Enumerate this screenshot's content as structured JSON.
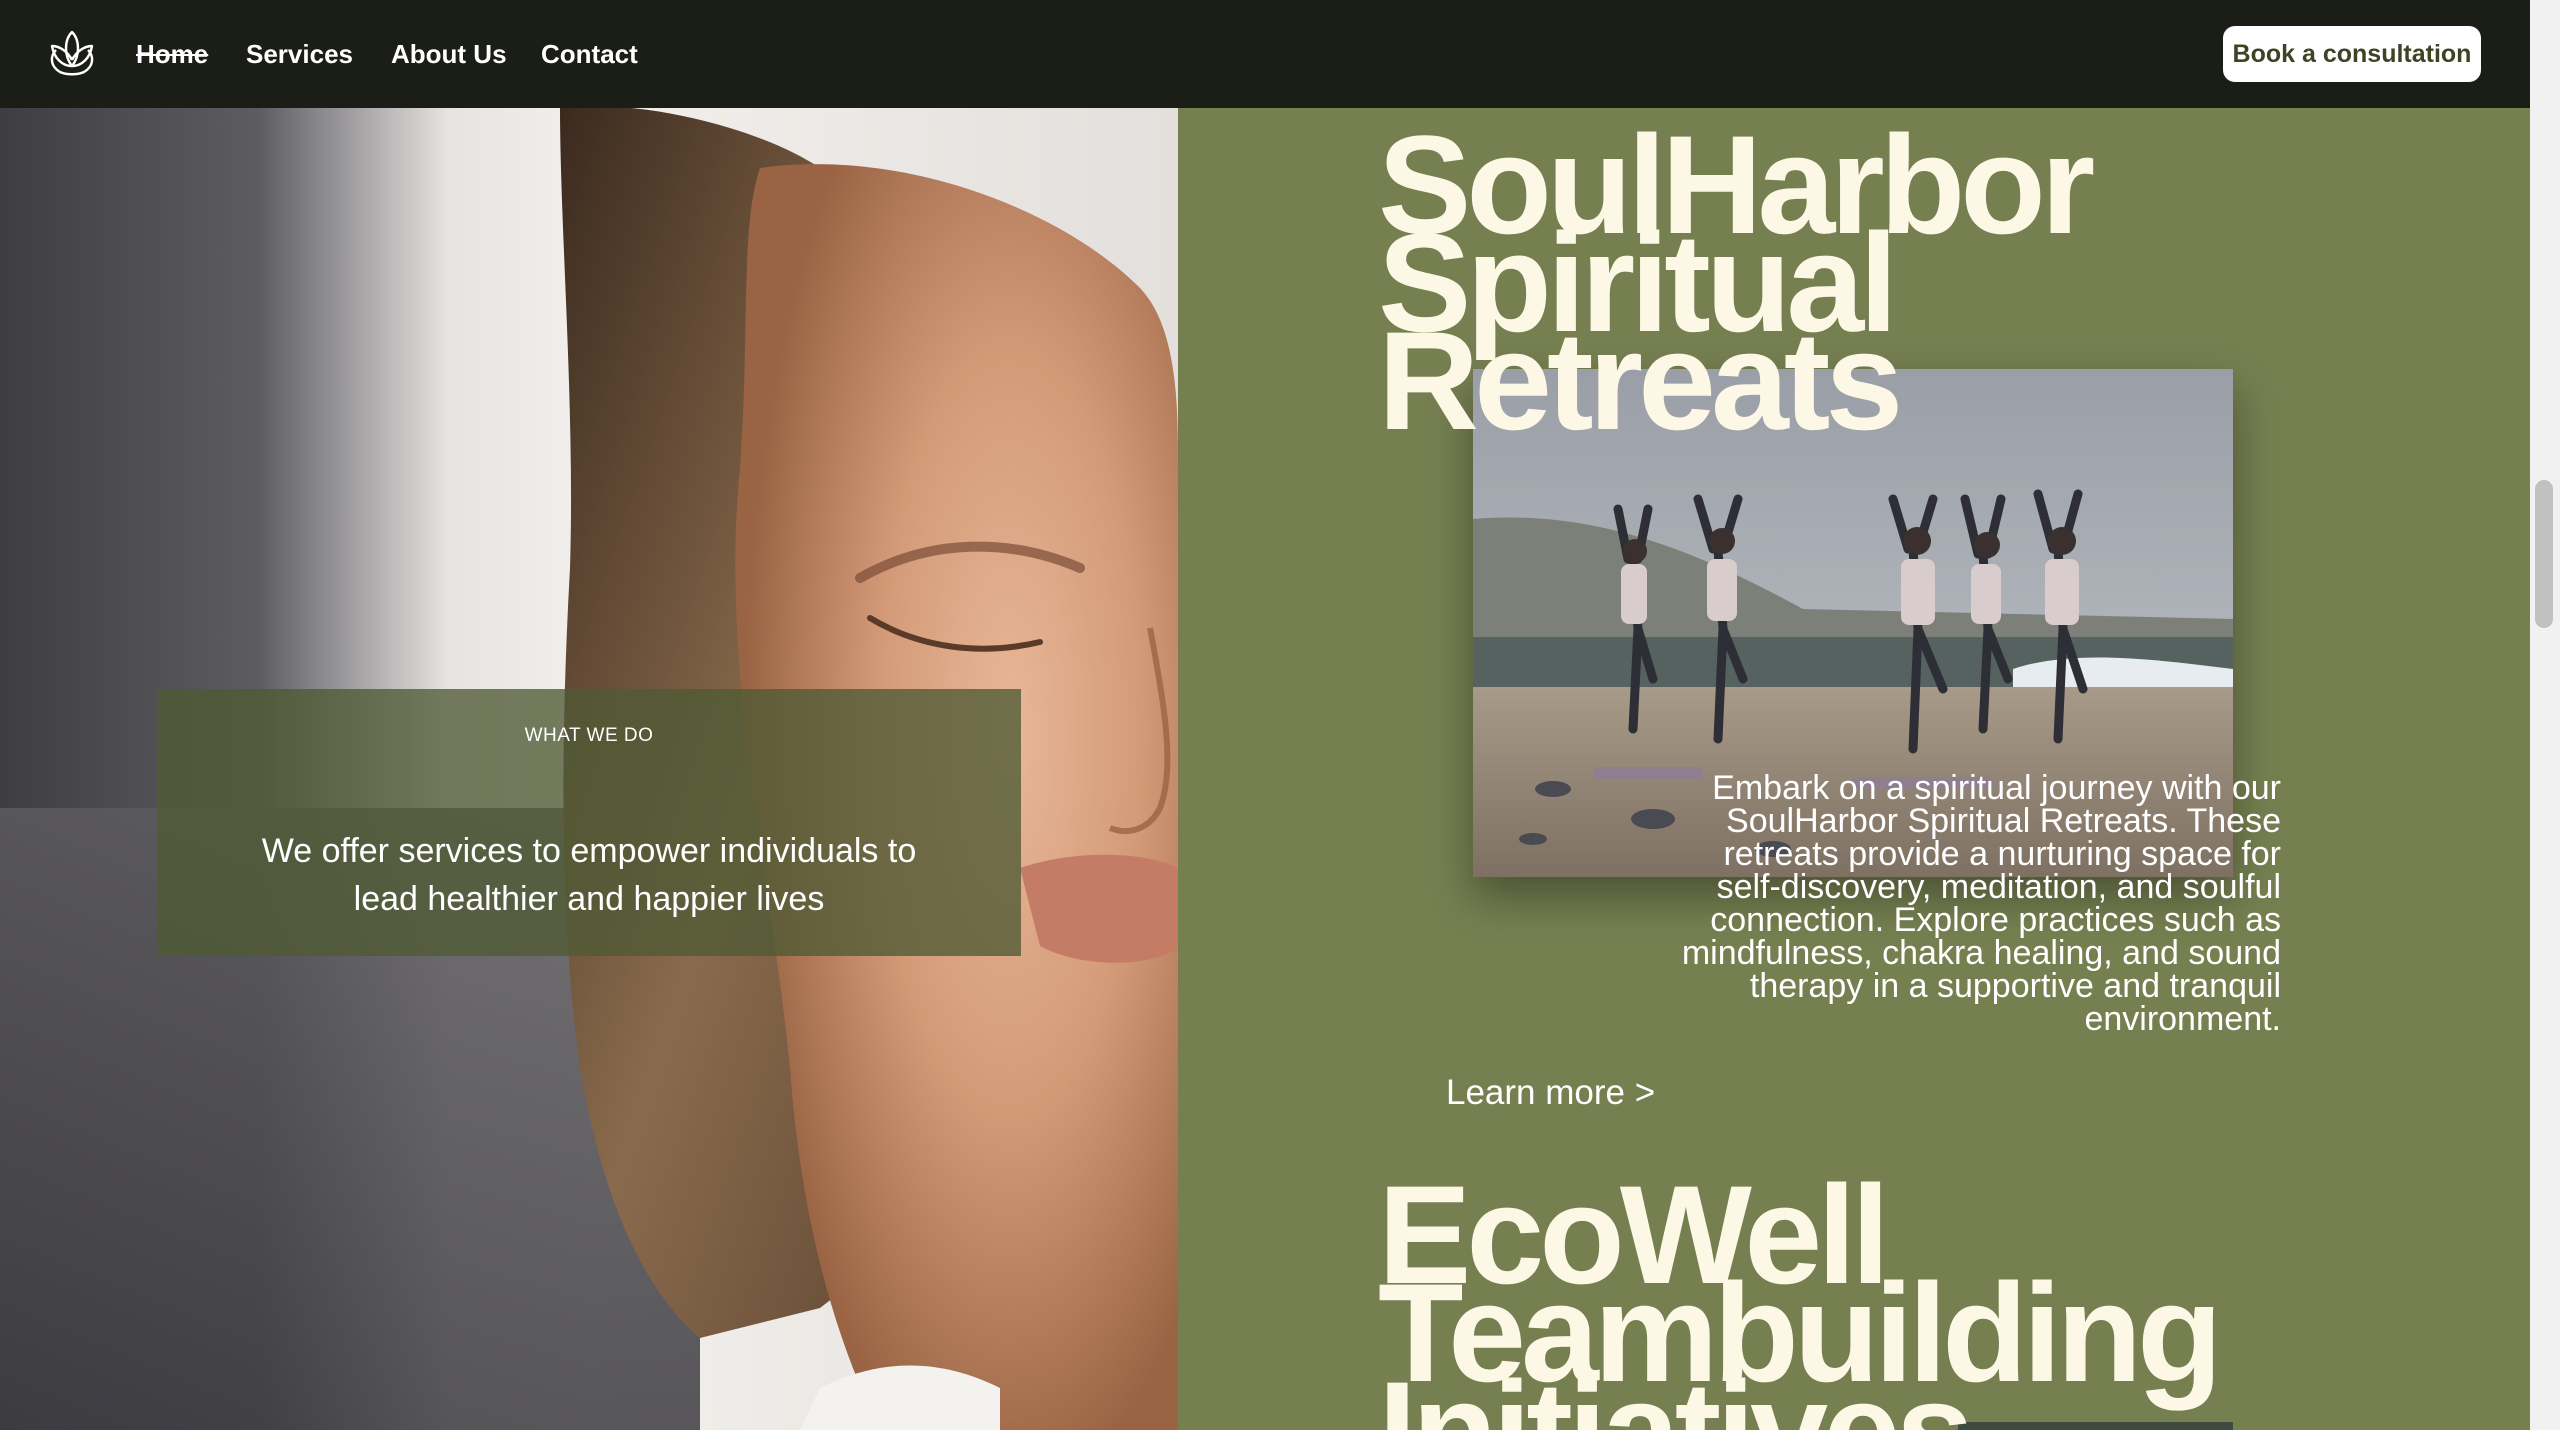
{
  "header": {
    "logo_icon": "lotus-icon",
    "nav": {
      "home": "Home",
      "services": "Services",
      "about": "About Us",
      "contact": "Contact"
    },
    "cta_label": "Book a consultation"
  },
  "hero": {
    "eyebrow": "WHAT WE DO",
    "tagline": "We offer services to empower individuals to lead healthier and happier lives"
  },
  "services": [
    {
      "title_lines": [
        "SoulHarbor",
        "Spiritual",
        "Retreats"
      ],
      "description": "Embark on a spiritual journey with our SoulHarbor Spiritual Retreats. These retreats provide a nurturing space for self-discovery, meditation, and soulful connection. Explore practices such as mindfulness, chakra healing, and sound therapy in a supportive and tranquil environment.",
      "link_label": "Learn more >"
    },
    {
      "title_lines": [
        "EcoWell",
        "Teambuilding",
        "Initiatives"
      ]
    }
  ],
  "colors": {
    "header_bg": "#1b1e16",
    "panel_green": "#757f50",
    "title_cream": "#fdf8e6",
    "button_bg": "#ffffff"
  }
}
